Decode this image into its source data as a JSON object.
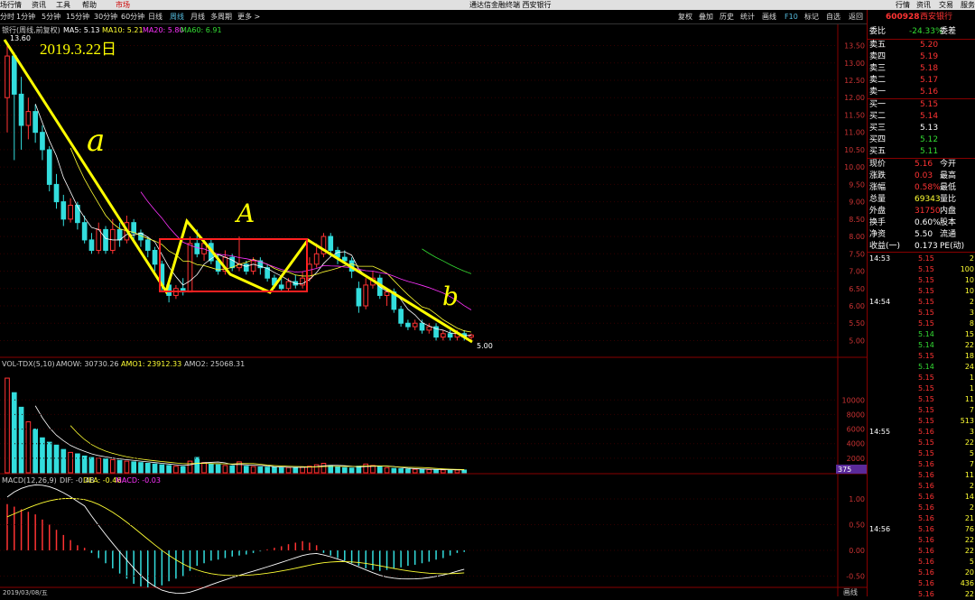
{
  "menubar": {
    "items": [
      "场行情",
      "资讯",
      "工具",
      "帮助",
      "市场"
    ],
    "center_title": "通达信金融终端 西安银行",
    "right_items": [
      "行情",
      "资讯",
      "交易",
      "服务"
    ]
  },
  "toolbar": {
    "periods": [
      "分时",
      "1分钟",
      "5分钟",
      "15分钟",
      "30分钟",
      "60分钟",
      "日线",
      "周线",
      "月线",
      "多周期",
      "更多 >"
    ],
    "active_period": "周线",
    "tools": [
      "复权",
      "叠加",
      "历史",
      "统计",
      "画线",
      "F10",
      "标记",
      "自选",
      "返回"
    ]
  },
  "chart_header": {
    "stock_label": "银行(周线,前复权)",
    "ma_labels": [
      "MA5: 5.13",
      "MA10: 5.21",
      "MA20: 5.80",
      "MA60: 6.91"
    ],
    "ma_colors": [
      "#ffffff",
      "#ffff33",
      "#ff33ff",
      "#33dd33"
    ]
  },
  "vol_header": {
    "labels": [
      "VOL-TDX(5,10)",
      "AMOW: 30730.26",
      "AMO1: 23912.33",
      "AMO2: 25068.31"
    ]
  },
  "macd_header": {
    "labels": [
      "MACD(12,26,9)",
      "DIF: -0.48",
      "DEA: -0.46",
      "MACD: -0.03"
    ]
  },
  "annotations": {
    "date_text": "2019.3.22日",
    "wave_a_lower": "a",
    "wave_A_upper": "A",
    "wave_b_lower": "b",
    "high_marker": "13.60",
    "low_marker": "5.00",
    "tab_label": "画线"
  },
  "price_axis": [
    "13.50",
    "13.00",
    "12.50",
    "12.00",
    "11.50",
    "11.00",
    "10.50",
    "10.00",
    "9.50",
    "9.00",
    "8.50",
    "8.00",
    "7.50",
    "7.00",
    "6.50",
    "6.00",
    "5.50",
    "5.00"
  ],
  "volume_axis": [
    "10000",
    "8000",
    "6000",
    "4000",
    "2000",
    "375"
  ],
  "macd_axis": [
    "1.00",
    "0.50",
    "0.00",
    "-0.50"
  ],
  "date_axis": [
    "2019/03/08/五"
  ],
  "quotes": {
    "code": "600928",
    "name": "西安银行",
    "webi_label": "委比",
    "webi_value": "-24.33%",
    "weicha_label": "委差",
    "asks": [
      {
        "label": "卖五",
        "price": "5.20"
      },
      {
        "label": "卖四",
        "price": "5.19"
      },
      {
        "label": "卖三",
        "price": "5.18"
      },
      {
        "label": "卖二",
        "price": "5.17"
      },
      {
        "label": "卖一",
        "price": "5.16"
      }
    ],
    "bids": [
      {
        "label": "买一",
        "price": "5.15"
      },
      {
        "label": "买二",
        "price": "5.14"
      },
      {
        "label": "买三",
        "price": "5.13"
      },
      {
        "label": "买四",
        "price": "5.12"
      },
      {
        "label": "买五",
        "price": "5.11"
      }
    ],
    "stats": [
      {
        "label": "现价",
        "value": "5.16",
        "right": "今开"
      },
      {
        "label": "涨跌",
        "value": "0.03",
        "right": "最高"
      },
      {
        "label": "涨幅",
        "value": "0.58%",
        "right": "最低"
      },
      {
        "label": "总量",
        "value": "69343",
        "right": "量比"
      },
      {
        "label": "外盘",
        "value": "31750",
        "right": "内盘"
      },
      {
        "label": "换手",
        "value": "0.60%",
        "right": "股本"
      },
      {
        "label": "净资",
        "value": "5.50",
        "right": "流通"
      },
      {
        "label": "收益(一)",
        "value": "0.173",
        "right": "PE(动)"
      }
    ],
    "ticks": [
      {
        "time": "14:53",
        "price": "5.15",
        "vol": "2"
      },
      {
        "time": "",
        "price": "5.15",
        "vol": "100"
      },
      {
        "time": "",
        "price": "5.15",
        "vol": "10"
      },
      {
        "time": "",
        "price": "5.15",
        "vol": "10"
      },
      {
        "time": "14:54",
        "price": "5.15",
        "vol": "2"
      },
      {
        "time": "",
        "price": "5.15",
        "vol": "3"
      },
      {
        "time": "",
        "price": "5.15",
        "vol": "8"
      },
      {
        "time": "",
        "price": "5.14",
        "vol": "15"
      },
      {
        "time": "",
        "price": "5.14",
        "vol": "22"
      },
      {
        "time": "",
        "price": "5.15",
        "vol": "18"
      },
      {
        "time": "",
        "price": "5.14",
        "vol": "24"
      },
      {
        "time": "",
        "price": "5.15",
        "vol": "1"
      },
      {
        "time": "",
        "price": "5.15",
        "vol": "1"
      },
      {
        "time": "",
        "price": "5.15",
        "vol": "11"
      },
      {
        "time": "",
        "price": "5.15",
        "vol": "7"
      },
      {
        "time": "",
        "price": "5.15",
        "vol": "513"
      },
      {
        "time": "14:55",
        "price": "5.16",
        "vol": "3"
      },
      {
        "time": "",
        "price": "5.15",
        "vol": "22"
      },
      {
        "time": "",
        "price": "5.15",
        "vol": "5"
      },
      {
        "time": "",
        "price": "5.16",
        "vol": "7"
      },
      {
        "time": "",
        "price": "5.16",
        "vol": "11"
      },
      {
        "time": "",
        "price": "5.16",
        "vol": "2"
      },
      {
        "time": "",
        "price": "5.16",
        "vol": "14"
      },
      {
        "time": "",
        "price": "5.16",
        "vol": "2"
      },
      {
        "time": "",
        "price": "5.16",
        "vol": "21"
      },
      {
        "time": "14:56",
        "price": "5.16",
        "vol": "76"
      },
      {
        "time": "",
        "price": "5.16",
        "vol": "22"
      },
      {
        "time": "",
        "price": "5.16",
        "vol": "22"
      },
      {
        "time": "",
        "price": "5.16",
        "vol": "5"
      },
      {
        "time": "",
        "price": "5.16",
        "vol": "20"
      },
      {
        "time": "",
        "price": "5.16",
        "vol": "436"
      },
      {
        "time": "",
        "price": "5.16",
        "vol": "22"
      }
    ]
  },
  "colors": {
    "up": "#ff3333",
    "down": "#33dddd",
    "annotation_yellow": "#ffff00",
    "box_red": "#ff2020"
  },
  "chart_data": {
    "type": "candlestick",
    "period": "weekly",
    "ylim": [
      4.7,
      13.8
    ],
    "candles": [
      {
        "o": 12.0,
        "c": 13.2,
        "h": 13.6,
        "l": 11.0
      },
      {
        "o": 13.2,
        "c": 12.1,
        "h": 13.3,
        "l": 10.2
      },
      {
        "o": 12.1,
        "c": 11.2,
        "h": 12.6,
        "l": 10.5
      },
      {
        "o": 11.2,
        "c": 11.6,
        "h": 12.0,
        "l": 10.8
      },
      {
        "o": 11.6,
        "c": 11.0,
        "h": 11.8,
        "l": 10.7
      },
      {
        "o": 11.0,
        "c": 10.5,
        "h": 11.2,
        "l": 10.2
      },
      {
        "o": 10.5,
        "c": 9.5,
        "h": 10.6,
        "l": 9.3
      },
      {
        "o": 9.5,
        "c": 9.0,
        "h": 9.8,
        "l": 8.8
      },
      {
        "o": 9.0,
        "c": 8.5,
        "h": 9.2,
        "l": 8.3
      },
      {
        "o": 8.5,
        "c": 8.9,
        "h": 9.1,
        "l": 8.4
      },
      {
        "o": 8.9,
        "c": 8.4,
        "h": 9.0,
        "l": 8.2
      },
      {
        "o": 8.4,
        "c": 7.9,
        "h": 8.6,
        "l": 7.8
      },
      {
        "o": 7.9,
        "c": 7.6,
        "h": 8.1,
        "l": 7.5
      },
      {
        "o": 7.6,
        "c": 8.2,
        "h": 8.4,
        "l": 7.5
      },
      {
        "o": 8.2,
        "c": 7.6,
        "h": 8.3,
        "l": 7.5
      },
      {
        "o": 7.6,
        "c": 8.2,
        "h": 8.5,
        "l": 7.5
      },
      {
        "o": 8.2,
        "c": 7.9,
        "h": 8.4,
        "l": 7.7
      },
      {
        "o": 7.9,
        "c": 8.4,
        "h": 8.6,
        "l": 7.8
      },
      {
        "o": 8.4,
        "c": 8.1,
        "h": 8.5,
        "l": 7.9
      },
      {
        "o": 8.1,
        "c": 7.9,
        "h": 8.2,
        "l": 7.7
      },
      {
        "o": 7.9,
        "c": 7.6,
        "h": 8.0,
        "l": 7.4
      },
      {
        "o": 7.6,
        "c": 7.2,
        "h": 7.7,
        "l": 7.0
      },
      {
        "o": 7.2,
        "c": 6.6,
        "h": 7.3,
        "l": 6.4
      },
      {
        "o": 6.6,
        "c": 6.3,
        "h": 6.8,
        "l": 6.1
      },
      {
        "o": 6.3,
        "c": 6.5,
        "h": 6.6,
        "l": 6.2
      },
      {
        "o": 6.5,
        "c": 6.4,
        "h": 6.8,
        "l": 6.3
      },
      {
        "o": 6.4,
        "c": 7.8,
        "h": 8.0,
        "l": 6.4
      },
      {
        "o": 7.8,
        "c": 7.5,
        "h": 8.2,
        "l": 7.4
      },
      {
        "o": 7.5,
        "c": 7.8,
        "h": 7.9,
        "l": 7.3
      },
      {
        "o": 7.8,
        "c": 7.3,
        "h": 7.9,
        "l": 7.2
      },
      {
        "o": 7.3,
        "c": 7.0,
        "h": 7.5,
        "l": 6.9
      },
      {
        "o": 7.0,
        "c": 7.4,
        "h": 7.6,
        "l": 6.9
      },
      {
        "o": 7.4,
        "c": 7.1,
        "h": 7.5,
        "l": 7.0
      },
      {
        "o": 7.1,
        "c": 7.2,
        "h": 8.0,
        "l": 7.0
      },
      {
        "o": 7.2,
        "c": 7.0,
        "h": 7.3,
        "l": 6.9
      },
      {
        "o": 7.0,
        "c": 7.3,
        "h": 7.4,
        "l": 6.9
      },
      {
        "o": 7.3,
        "c": 7.1,
        "h": 7.4,
        "l": 6.9
      },
      {
        "o": 7.1,
        "c": 6.8,
        "h": 7.2,
        "l": 6.7
      },
      {
        "o": 6.8,
        "c": 6.6,
        "h": 6.9,
        "l": 6.5
      },
      {
        "o": 6.6,
        "c": 6.5,
        "h": 6.8,
        "l": 6.4
      },
      {
        "o": 6.5,
        "c": 6.7,
        "h": 6.8,
        "l": 6.4
      },
      {
        "o": 6.7,
        "c": 6.6,
        "h": 6.9,
        "l": 6.5
      },
      {
        "o": 6.6,
        "c": 6.8,
        "h": 7.0,
        "l": 6.5
      },
      {
        "o": 6.8,
        "c": 7.2,
        "h": 7.4,
        "l": 6.7
      },
      {
        "o": 7.2,
        "c": 7.5,
        "h": 7.8,
        "l": 7.1
      },
      {
        "o": 7.5,
        "c": 8.0,
        "h": 8.1,
        "l": 7.4
      },
      {
        "o": 8.0,
        "c": 7.6,
        "h": 8.1,
        "l": 7.4
      },
      {
        "o": 7.6,
        "c": 7.4,
        "h": 7.7,
        "l": 7.2
      },
      {
        "o": 7.4,
        "c": 7.3,
        "h": 7.6,
        "l": 7.2
      },
      {
        "o": 7.3,
        "c": 7.0,
        "h": 7.4,
        "l": 6.8
      },
      {
        "o": 6.5,
        "c": 6.0,
        "h": 6.7,
        "l": 5.8
      },
      {
        "o": 6.0,
        "c": 6.6,
        "h": 6.8,
        "l": 5.9
      },
      {
        "o": 6.6,
        "c": 6.8,
        "h": 7.0,
        "l": 6.5
      },
      {
        "o": 6.8,
        "c": 6.3,
        "h": 6.9,
        "l": 6.2
      },
      {
        "o": 6.3,
        "c": 6.4,
        "h": 6.5,
        "l": 6.0
      },
      {
        "o": 6.4,
        "c": 5.9,
        "h": 6.5,
        "l": 5.8
      },
      {
        "o": 5.9,
        "c": 5.5,
        "h": 6.0,
        "l": 5.4
      },
      {
        "o": 5.5,
        "c": 5.4,
        "h": 5.6,
        "l": 5.3
      },
      {
        "o": 5.4,
        "c": 5.5,
        "h": 5.6,
        "l": 5.3
      },
      {
        "o": 5.5,
        "c": 5.3,
        "h": 5.6,
        "l": 5.2
      },
      {
        "o": 5.3,
        "c": 5.4,
        "h": 5.5,
        "l": 5.2
      },
      {
        "o": 5.4,
        "c": 5.1,
        "h": 5.5,
        "l": 5.0
      },
      {
        "o": 5.1,
        "c": 5.2,
        "h": 5.3,
        "l": 5.0
      },
      {
        "o": 5.2,
        "c": 5.1,
        "h": 5.3,
        "l": 5.0
      },
      {
        "o": 5.1,
        "c": 5.2,
        "h": 5.3,
        "l": 5.0
      },
      {
        "o": 5.2,
        "c": 5.1,
        "h": 5.3,
        "l": 5.0
      },
      {
        "o": 5.1,
        "c": 5.16,
        "h": 5.2,
        "l": 5.0
      }
    ],
    "volume": [
      13000,
      11000,
      9000,
      7000,
      6000,
      4800,
      4200,
      3800,
      3200,
      2800,
      2600,
      2300,
      2100,
      2000,
      1900,
      1800,
      1700,
      1600,
      1500,
      1400,
      1300,
      1200,
      1100,
      1000,
      900,
      850,
      1600,
      2100,
      1400,
      1200,
      1100,
      1000,
      950,
      1500,
      900,
      850,
      800,
      780,
      760,
      740,
      720,
      700,
      800,
      900,
      1100,
      1300,
      1000,
      800,
      700,
      650,
      900,
      1200,
      1000,
      800,
      700,
      600,
      550,
      500,
      480,
      460,
      440,
      420,
      400,
      390,
      380,
      375
    ],
    "macd_hist": [
      0.9,
      0.85,
      0.8,
      0.75,
      0.7,
      0.6,
      0.5,
      0.4,
      0.3,
      0.2,
      0.1,
      0.05,
      -0.05,
      -0.15,
      -0.25,
      -0.35,
      -0.45,
      -0.55,
      -0.65,
      -0.7,
      -0.72,
      -0.7,
      -0.68,
      -0.6,
      -0.55,
      -0.5,
      -0.4,
      -0.3,
      -0.25,
      -0.2,
      -0.18,
      -0.15,
      -0.12,
      -0.1,
      -0.08,
      -0.05,
      -0.02,
      0.02,
      0.05,
      0.08,
      0.12,
      0.15,
      0.18,
      0.15,
      0.1,
      -0.05,
      -0.1,
      -0.15,
      -0.2,
      -0.25,
      -0.3,
      -0.35,
      -0.38,
      -0.4,
      -0.38,
      -0.35,
      -0.33,
      -0.3,
      -0.28,
      -0.25,
      -0.22,
      -0.18,
      -0.15,
      -0.1,
      -0.05,
      -0.03
    ]
  }
}
